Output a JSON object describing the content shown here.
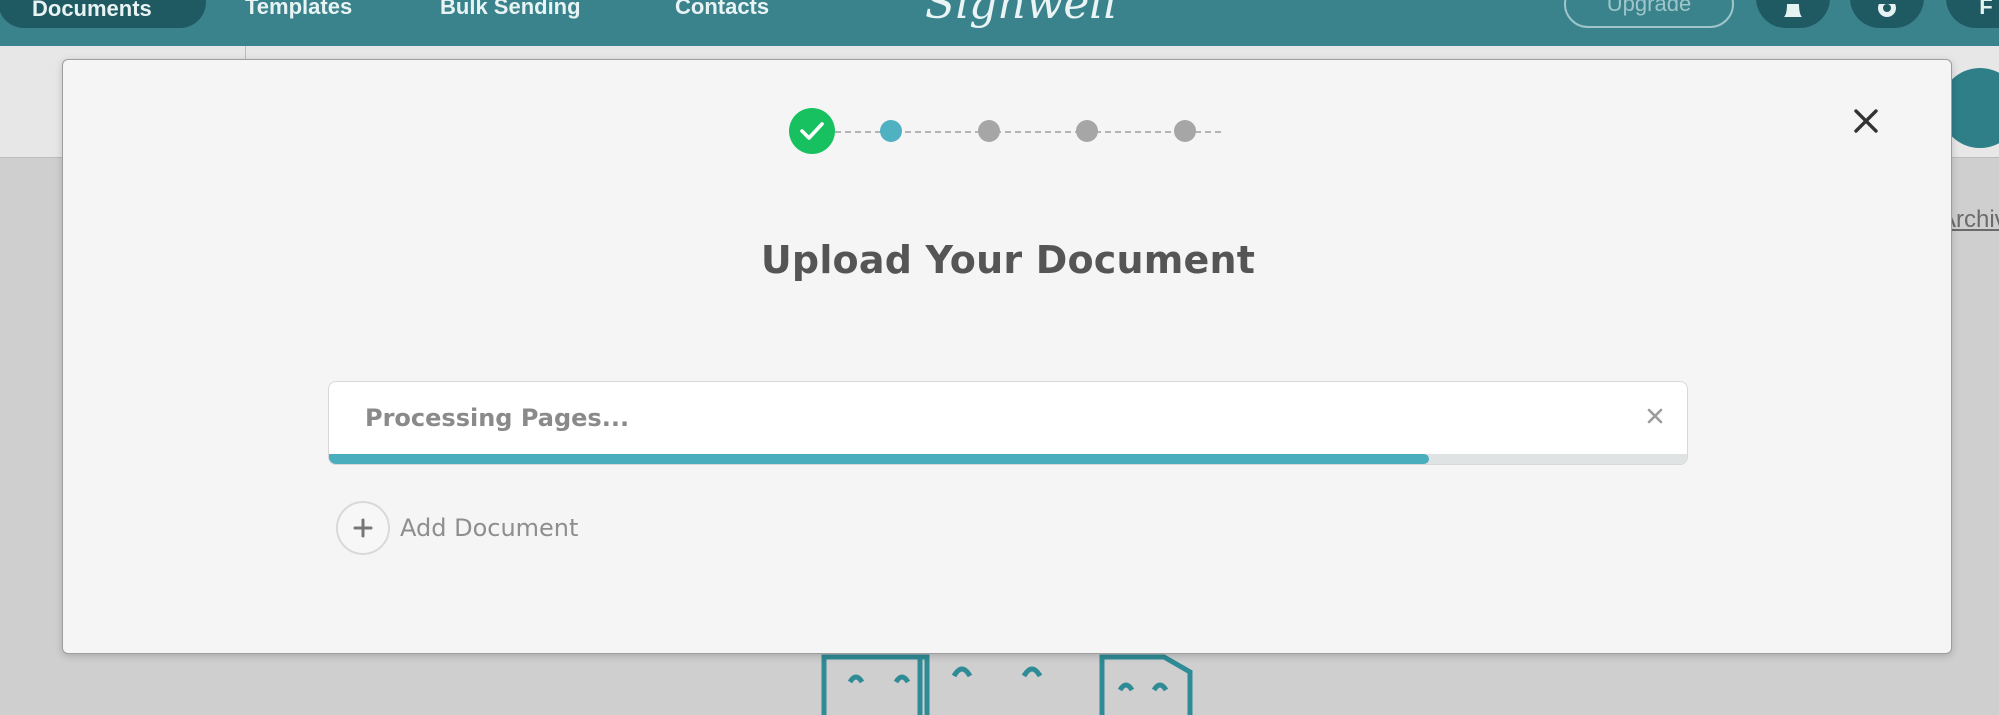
{
  "topbar": {
    "nav_items": [
      "Documents",
      "Templates",
      "Bulk Sending",
      "Contacts"
    ],
    "logo_text": "Signwell",
    "upgrade_label": "Upgrade",
    "avatar_initial": "F",
    "background_color": "#3a838c"
  },
  "background": {
    "archived_link": "Archived"
  },
  "modal": {
    "title": "Upload Your Document",
    "close_icon": "close-icon",
    "stepper": {
      "total_steps": 5,
      "completed_steps": 1,
      "active_step": 2,
      "colors": {
        "done": "#17c160",
        "active": "#4fb1c1",
        "pending": "#a6a6a6"
      }
    },
    "upload": {
      "status_text": "Processing Pages...",
      "progress_percent": 81,
      "progress_color": "#4aaebd"
    },
    "add_document_label": "Add Document"
  }
}
